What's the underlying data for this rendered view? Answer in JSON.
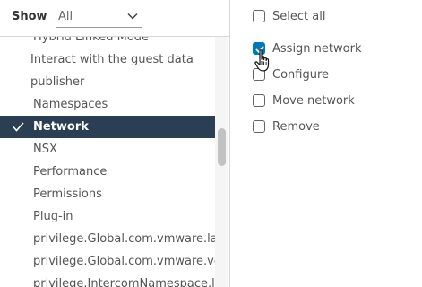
{
  "filter": {
    "label": "Show",
    "selected": "All"
  },
  "privileges": [
    {
      "label": "Hybrid Linked Mode",
      "selected": false
    },
    {
      "label": "Interact with the guest data",
      "selected": false
    },
    {
      "label": "publisher",
      "selected": false
    },
    {
      "label": "Namespaces",
      "selected": false
    },
    {
      "label": "Network",
      "selected": true
    },
    {
      "label": "NSX",
      "selected": false
    },
    {
      "label": "Performance",
      "selected": false
    },
    {
      "label": "Permissions",
      "selected": false
    },
    {
      "label": "Plug-in",
      "selected": false
    },
    {
      "label": "privilege.Global.com.vmware.labe",
      "selected": false
    },
    {
      "label": "privilege.Global.com.vmware.vcc",
      "selected": false
    },
    {
      "label": "privilege.IntercomNamespace.lab",
      "selected": false
    }
  ],
  "permissions": {
    "select_all": {
      "label": "Select all",
      "checked": false
    },
    "items": [
      {
        "label": "Assign network",
        "checked": true
      },
      {
        "label": "Configure",
        "checked": false
      },
      {
        "label": "Move network",
        "checked": false
      },
      {
        "label": "Remove",
        "checked": false
      }
    ]
  }
}
